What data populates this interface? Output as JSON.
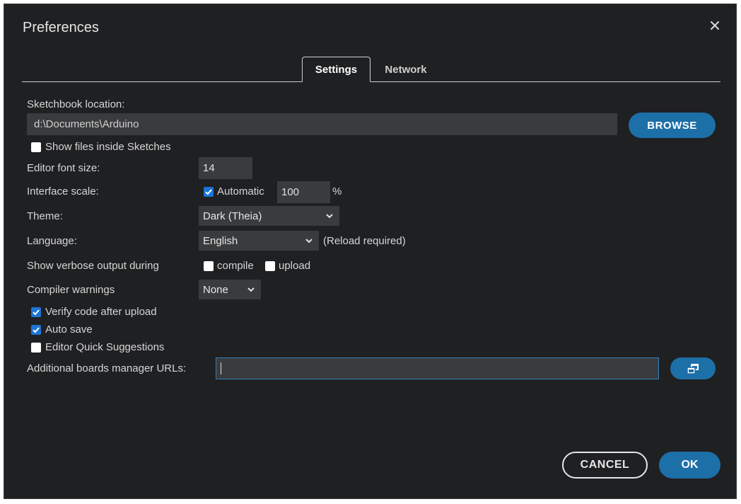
{
  "dialog": {
    "title": "Preferences",
    "close_icon": "close-icon"
  },
  "tabs": [
    {
      "label": "Settings",
      "active": true
    },
    {
      "label": "Network",
      "active": false
    }
  ],
  "sketchbook": {
    "label": "Sketchbook location:",
    "path": "d:\\Documents\\Arduino",
    "browse_label": "BROWSE"
  },
  "show_files": {
    "label": "Show files inside Sketches",
    "checked": false
  },
  "font_size": {
    "label": "Editor font size:",
    "value": "14"
  },
  "interface_scale": {
    "label": "Interface scale:",
    "automatic_label": "Automatic",
    "automatic_checked": true,
    "value": "100",
    "unit": "%"
  },
  "theme": {
    "label": "Theme:",
    "value": "Dark (Theia)"
  },
  "language": {
    "label": "Language:",
    "value": "English",
    "note": "(Reload required)"
  },
  "verbose": {
    "label": "Show verbose output during",
    "compile_label": "compile",
    "compile_checked": false,
    "upload_label": "upload",
    "upload_checked": false
  },
  "warnings": {
    "label": "Compiler warnings",
    "value": "None"
  },
  "verify": {
    "label": "Verify code after upload",
    "checked": true
  },
  "auto_save": {
    "label": "Auto save",
    "checked": true
  },
  "quick_suggestions": {
    "label": "Editor Quick Suggestions",
    "checked": false
  },
  "boards_urls": {
    "label": "Additional boards manager URLs:",
    "value": "",
    "button_icon": "open-window-icon"
  },
  "footer": {
    "cancel_label": "CANCEL",
    "ok_label": "OK"
  },
  "colors": {
    "accent": "#1d6fa8",
    "checkbox": "#1c74d4",
    "background": "#1f2022",
    "field": "#3a3b3d"
  }
}
